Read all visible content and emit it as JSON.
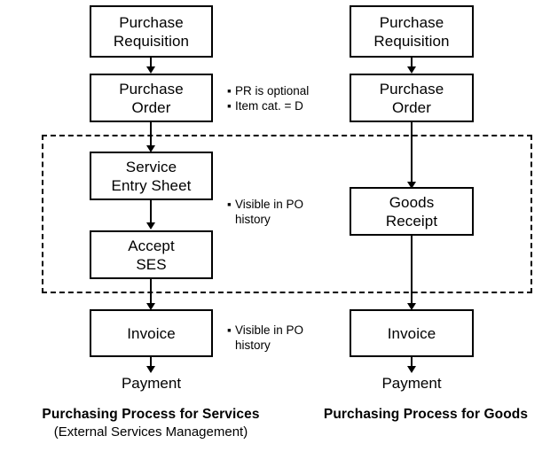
{
  "diagram": {
    "title_left": "Purchasing Process for Services",
    "subtitle_left": "(External Services Management)",
    "title_right": "Purchasing Process for Goods"
  },
  "services_flow": {
    "nodes": [
      {
        "id": "pr",
        "label": "Purchase\nRequisition"
      },
      {
        "id": "po",
        "label": "Purchase\nOrder"
      },
      {
        "id": "ses",
        "label": "Service\nEntry Sheet"
      },
      {
        "id": "accept",
        "label": "Accept\nSES"
      },
      {
        "id": "invoice",
        "label": "Invoice"
      }
    ],
    "terminal": "Payment"
  },
  "goods_flow": {
    "nodes": [
      {
        "id": "pr",
        "label": "Purchase\nRequisition"
      },
      {
        "id": "po",
        "label": "Purchase\nOrder"
      },
      {
        "id": "gr",
        "label": "Goods\nReceipt"
      },
      {
        "id": "invoice",
        "label": "Invoice"
      }
    ],
    "terminal": "Payment"
  },
  "annotations": {
    "po_note": {
      "bullet": "▪",
      "lines": [
        "PR is optional",
        "Item cat. = D"
      ]
    },
    "ses_note": {
      "bullet": "▪",
      "lines": [
        "Visible in PO",
        "history"
      ]
    },
    "invoice_note": {
      "bullet": "▪",
      "lines": [
        "Visible in PO",
        "history"
      ]
    }
  },
  "colors": {
    "line": "#000000",
    "box_fill": "#ffffff",
    "text": "#000000",
    "background": "#ffffff"
  }
}
